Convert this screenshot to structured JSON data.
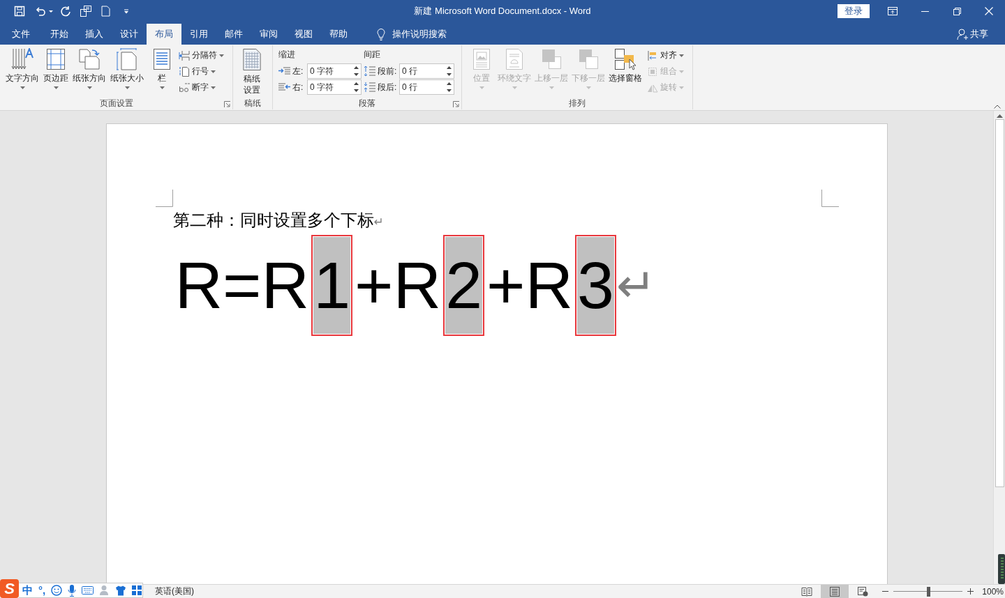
{
  "title_bar": {
    "title": "新建 Microsoft Word Document.docx - Word",
    "sign_in": "登录"
  },
  "tabs": [
    {
      "label": "文件",
      "selected": false
    },
    {
      "label": "开始",
      "selected": false
    },
    {
      "label": "插入",
      "selected": false
    },
    {
      "label": "设计",
      "selected": false
    },
    {
      "label": "布局",
      "selected": true
    },
    {
      "label": "引用",
      "selected": false
    },
    {
      "label": "邮件",
      "selected": false
    },
    {
      "label": "审阅",
      "selected": false
    },
    {
      "label": "视图",
      "selected": false
    },
    {
      "label": "帮助",
      "selected": false
    }
  ],
  "tell_me": "操作说明搜索",
  "share": "共享",
  "ribbon": {
    "page_setup": {
      "label": "页面设置",
      "large_buttons": [
        {
          "kind": "direction",
          "label": "文字方向",
          "dropdown": true
        },
        {
          "kind": "margins",
          "label": "页边距",
          "dropdown": true
        },
        {
          "kind": "orientation",
          "label": "纸张方向",
          "dropdown": true
        },
        {
          "kind": "size",
          "label": "纸张大小",
          "dropdown": true
        },
        {
          "kind": "columns",
          "label": "栏",
          "dropdown": true
        }
      ],
      "small_buttons": [
        {
          "kind": "breaks",
          "label": "分隔符",
          "dropdown": true
        },
        {
          "kind": "numbers",
          "label": "行号",
          "dropdown": true
        },
        {
          "kind": "hyphenation",
          "label": "断字",
          "dropdown": true
        }
      ]
    },
    "manuscript": {
      "label": "稿纸",
      "button": {
        "kind": "grid",
        "label": "稿纸设置"
      }
    },
    "paragraph": {
      "label": "段落",
      "indent": {
        "title": "缩进",
        "fields": [
          {
            "kind": "left",
            "label": "左:",
            "value": "0 字符"
          },
          {
            "kind": "right",
            "label": "右:",
            "value": "0 字符"
          }
        ]
      },
      "spacing": {
        "title": "间距",
        "fields": [
          {
            "kind": "before",
            "label": "段前:",
            "value": "0 行"
          },
          {
            "kind": "after",
            "label": "段后:",
            "value": "0 行"
          }
        ]
      }
    },
    "arrange": {
      "label": "排列",
      "large_buttons": [
        {
          "kind": "position",
          "label": "位置",
          "dropdown": true,
          "disabled": true
        },
        {
          "kind": "wrap",
          "label": "环绕文字",
          "dropdown": true,
          "disabled": true
        },
        {
          "kind": "forward",
          "label": "上移一层",
          "dropdown": true,
          "disabled": true
        },
        {
          "kind": "backward",
          "label": "下移一层",
          "dropdown": true,
          "disabled": true
        },
        {
          "kind": "selection",
          "label": "选择窗格",
          "dropdown": false,
          "disabled": false
        }
      ],
      "small_buttons": [
        {
          "kind": "align",
          "label": "对齐",
          "dropdown": true,
          "disabled": false
        },
        {
          "kind": "group",
          "label": "组合",
          "dropdown": true,
          "disabled": true
        },
        {
          "kind": "rotate",
          "label": "旋转",
          "dropdown": true,
          "disabled": true
        }
      ]
    }
  },
  "document": {
    "heading": {
      "text": "第二种：同时设置多个下标",
      "mark": "↵"
    },
    "formula": {
      "segments": [
        {
          "text": "R=R",
          "selected": false,
          "framed": false
        },
        {
          "text": "1",
          "selected": true,
          "framed": true
        },
        {
          "text": "+R",
          "selected": false,
          "framed": false
        },
        {
          "text": "2",
          "selected": true,
          "framed": true
        },
        {
          "text": "+R",
          "selected": false,
          "framed": false
        },
        {
          "text": "3",
          "selected": true,
          "framed": true
        }
      ],
      "mark": "↵"
    }
  },
  "status_bar": {
    "language": "英语(美国)",
    "views": [
      {
        "kind": "read",
        "selected": false
      },
      {
        "kind": "print",
        "selected": true
      },
      {
        "kind": "web",
        "selected": false
      }
    ],
    "zoom": {
      "level": 0.5,
      "reading": "100%"
    }
  },
  "ime": {
    "logo": "S",
    "mode": "中",
    "punctuation": "°,"
  }
}
